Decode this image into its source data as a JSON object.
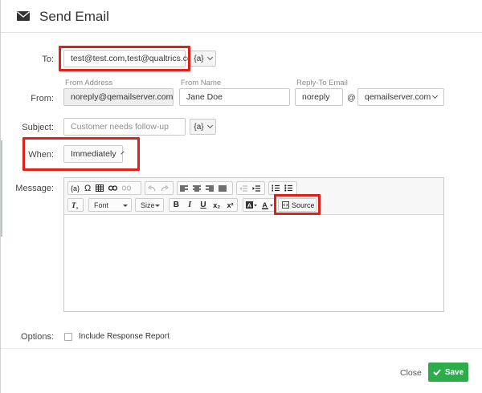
{
  "dialog": {
    "title": "Send Email"
  },
  "to": {
    "label": "To:",
    "value": "test@test.com,test@qualtrics.com",
    "piped_label": "{a}"
  },
  "from": {
    "label": "From:",
    "address_label": "From Address",
    "address_value": "noreply@qemailserver.com",
    "name_label": "From Name",
    "name_value": "Jane Doe",
    "reply_label": "Reply-To Email",
    "reply_user": "noreply",
    "reply_at": "@",
    "reply_domain": "qemailserver.com"
  },
  "subject": {
    "label": "Subject:",
    "placeholder": "Customer needs follow-up",
    "piped_label": "{a}"
  },
  "when": {
    "label": "When:",
    "value": "Immediately"
  },
  "message": {
    "label": "Message:",
    "toolbar": {
      "piped": "{a}",
      "omega": "Ω",
      "font": "Font",
      "size": "Size",
      "bold": "B",
      "italic": "I",
      "underline": "U",
      "subscript": "x₂",
      "superscript": "x²",
      "source": "Source"
    }
  },
  "options": {
    "label": "Options:",
    "include_report": "Include Response Report"
  },
  "footer": {
    "close": "Close",
    "save": "Save"
  },
  "colors": {
    "accent_red": "#e0201b",
    "save_green": "#2dac4a"
  }
}
